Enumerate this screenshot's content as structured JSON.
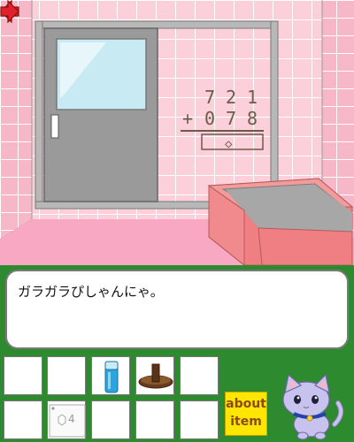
{
  "scene": {
    "addend1": [
      "7",
      "2",
      "1"
    ],
    "addend2": [
      "0",
      "7",
      "8"
    ],
    "operator": "+",
    "answer_symbol": "◇"
  },
  "message": "ガラガラぴしゃんにゃ。",
  "inventory": {
    "slot_card_label": "4"
  },
  "about": "about\nitem",
  "colors": {
    "tile": "#fbd0da",
    "floor": "#f8a8c2",
    "door": "#9a9a9a",
    "tub": "#f08080",
    "ui_green": "#2e8a2e",
    "about_yellow": "#ffe600"
  },
  "icons": [
    "left-arrow-icon",
    "right-arrow-icon",
    "water-bottle-icon",
    "stamp-icon",
    "card-icon",
    "cat-mascot-icon"
  ]
}
